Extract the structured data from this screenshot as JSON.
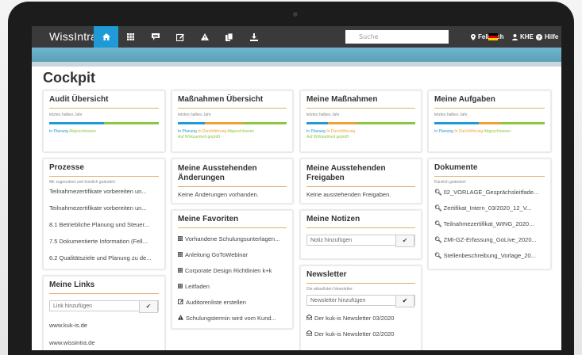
{
  "app": {
    "logo": "WissIntra",
    "logo_mark": "®"
  },
  "nav": {
    "icons": [
      "home-icon",
      "grid-icon",
      "message-icon",
      "edit-icon",
      "warning-icon",
      "documents-icon",
      "download-icon"
    ]
  },
  "search": {
    "placeholder": "Suche"
  },
  "topright": {
    "location": "Fellbach",
    "user": "KHE",
    "help": "Hilfe"
  },
  "page": {
    "title": "Cockpit"
  },
  "colors": {
    "accent": "#1e9ad6",
    "orange": "#f0a030",
    "green": "#8cc63f",
    "topbar": "#3a3a3a",
    "subbar": "#62aac2"
  },
  "cards": {
    "audit": {
      "title": "Audit Übersicht",
      "subtitle": "letztes halbes Jahr",
      "segments": [
        {
          "status": "In Planung",
          "share": 0.5
        },
        {
          "status": "Abgeschlossen",
          "share": 0.5
        }
      ],
      "legend": [
        "In Planung",
        "Abgeschlossen"
      ]
    },
    "massnahmen": {
      "title": "Maßnahmen Übersicht",
      "subtitle": "letztes halbes Jahr",
      "segments": [
        {
          "status": "In Planung",
          "share": 0.25
        },
        {
          "status": "In Durchführung",
          "share": 0.35
        },
        {
          "status": "Abgeschlossen",
          "share": 0.4
        }
      ],
      "legend": [
        "In Planung",
        "In Durchführung",
        "Abgeschlossen"
      ],
      "legend2": "Auf Wirksamkeit geprüft"
    },
    "meine_massnahmen": {
      "title": "Meine Maßnahmen",
      "subtitle": "letztes halbes Jahr",
      "segments": [
        {
          "status": "In Planung",
          "share": 0.2
        },
        {
          "status": "In Durchführung",
          "share": 0.25
        },
        {
          "status": "Abgeschlossen",
          "share": 0.55
        }
      ],
      "legend": [
        "In Planung",
        "In Durchführung"
      ],
      "legend2": "Auf Wirksamkeit geprüft"
    },
    "aufgaben": {
      "title": "Meine Aufgaben",
      "subtitle": "letztes halbes Jahr",
      "segments": [
        {
          "status": "In Planung",
          "share": 0.4
        },
        {
          "status": "In Durchführung",
          "share": 0.2
        },
        {
          "status": "Abgeschlossen",
          "share": 0.4
        }
      ],
      "legend": [
        "In Planung",
        "In Durchführung",
        "Abgeschlossen"
      ]
    },
    "prozesse": {
      "title": "Prozesse",
      "subtitle": "Mir zugeordnet und kürzlich geändert:",
      "items": [
        "Teilnahmezertifikate vorbereiten un...",
        "Teilnahmezertifikate vorbereiten un...",
        "8.1 Betriebliche Planung und Steuer...",
        "7.5 Dokumentierte Information (Fell...",
        "6.2 Qualitätsziele und Planung zu de..."
      ]
    },
    "ausstehende_aenderungen": {
      "title": "Meine Ausstehenden Änderungen",
      "text": "Keine Änderungen vorhanden."
    },
    "ausstehende_freigaben": {
      "title": "Meine Ausstehenden Freigaben",
      "text": "Keine ausstehenden Freigaben."
    },
    "dokumente": {
      "title": "Dokumente",
      "subtitle": "Kürzlich geändert:",
      "items": [
        "02_VORLAGE_Gesprächsleitfade...",
        "Zertifikat_Intern_03/2020_12_V...",
        "Teilnahmezertifikat_WING_2020...",
        "ZMI-GZ-Erfassung_GoLive_2020...",
        "Stellenbeschreibung_Vorlage_20..."
      ]
    },
    "favoriten": {
      "title": "Meine Favoriten",
      "items": [
        {
          "icon": "grid-icon",
          "label": "Vorhandene Schulungsunterlagen..."
        },
        {
          "icon": "grid-icon",
          "label": "Anleitung GoToWebinar"
        },
        {
          "icon": "grid-icon",
          "label": "Corporate Design Richtlinien k+k"
        },
        {
          "icon": "grid-icon",
          "label": "Leitfaden"
        },
        {
          "icon": "edit-icon",
          "label": "Auditorenliste erstellen"
        },
        {
          "icon": "warning-icon",
          "label": "Schulungstermin wird vom Kund..."
        }
      ]
    },
    "notizen": {
      "title": "Meine Notizen",
      "placeholder": "Notiz hinzufügen"
    },
    "newsletter": {
      "title": "Newsletter",
      "subtitle": "Die aktuellsten Newsletter:",
      "placeholder": "Newsletter hinzufügen",
      "items": [
        "Der kuk-is Newsletter 03/2020",
        "Der kuk-is Newsletter 02/2020"
      ]
    },
    "links": {
      "title": "Meine Links",
      "placeholder": "Link hinzufügen",
      "items": [
        "www.kuk-is.de",
        "www.wissintra.de"
      ]
    }
  }
}
